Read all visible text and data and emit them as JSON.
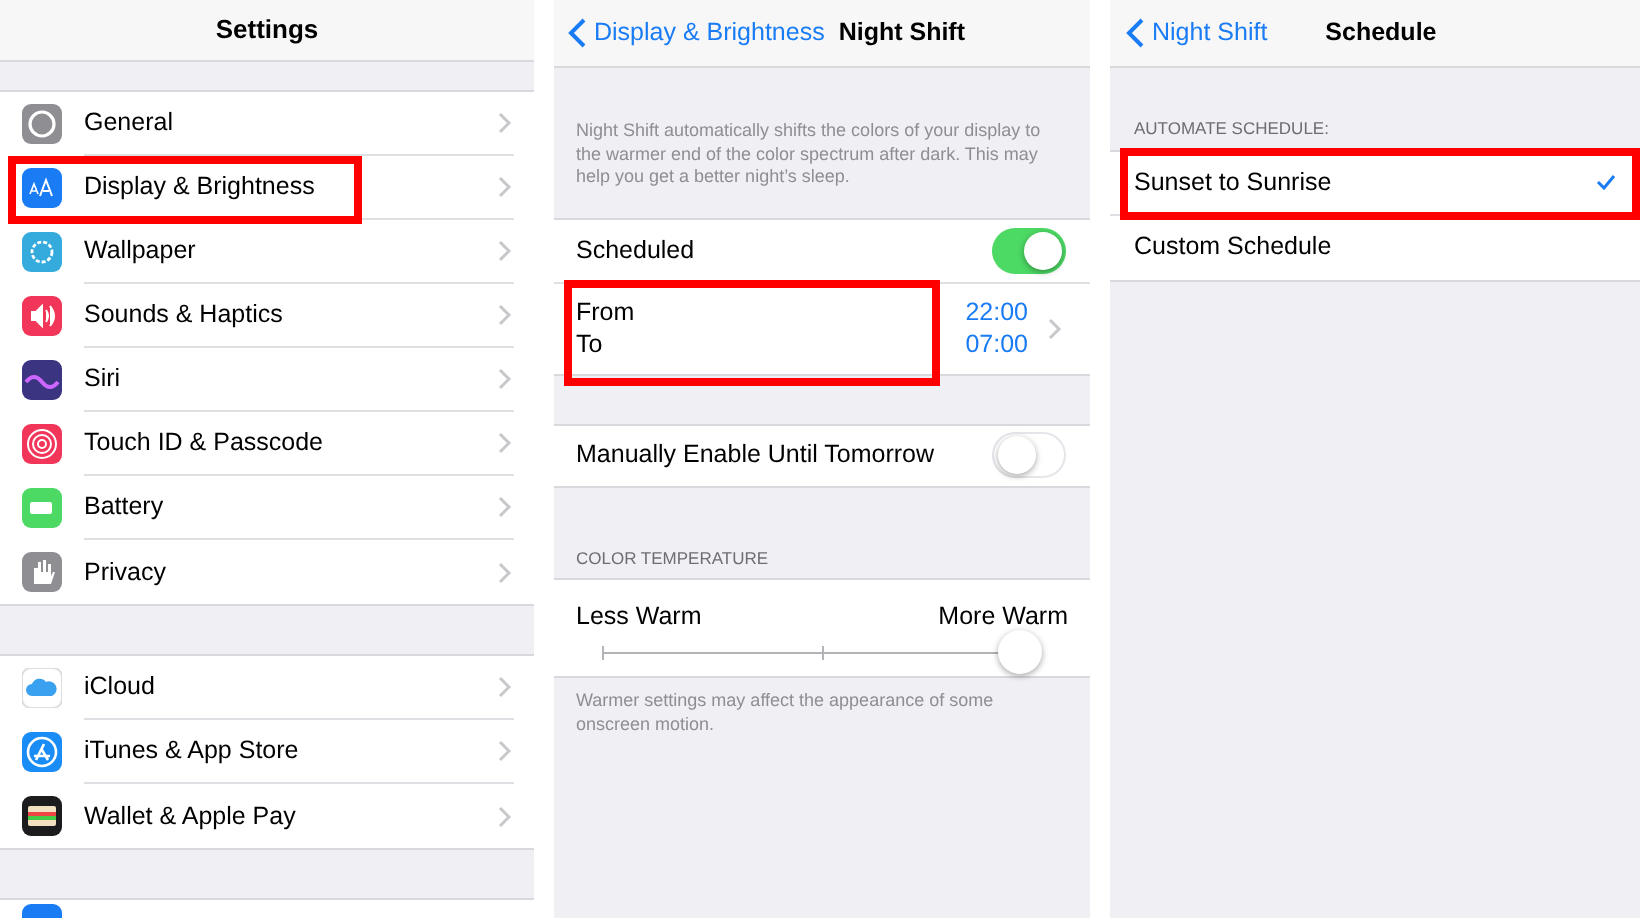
{
  "settings": {
    "title": "Settings",
    "groups": [
      [
        {
          "label": "General",
          "highlighted": false
        },
        {
          "label": "Display & Brightness",
          "highlighted": true
        },
        {
          "label": "Wallpaper",
          "highlighted": false
        },
        {
          "label": "Sounds & Haptics",
          "highlighted": false
        },
        {
          "label": "Siri",
          "highlighted": false
        },
        {
          "label": "Touch ID & Passcode",
          "highlighted": false
        },
        {
          "label": "Battery",
          "highlighted": false
        },
        {
          "label": "Privacy",
          "highlighted": false
        }
      ],
      [
        {
          "label": "iCloud",
          "highlighted": false
        },
        {
          "label": "iTunes & App Store",
          "highlighted": false
        },
        {
          "label": "Wallet & Apple Pay",
          "highlighted": false
        }
      ]
    ]
  },
  "night_shift": {
    "back": "Display & Brightness",
    "title": "Night Shift",
    "description": "Night Shift automatically shifts the colors of your display to the warmer end of the color spectrum after dark. This may help you get a better night’s sleep.",
    "scheduled": {
      "label": "Scheduled",
      "on": true
    },
    "from_to": {
      "from_label": "From",
      "to_label": "To",
      "from": "22:00",
      "to": "07:00",
      "highlighted": true
    },
    "manual": {
      "label": "Manually Enable Until Tomorrow",
      "on": false
    },
    "temperature_header": "COLOR TEMPERATURE",
    "temperature": {
      "min_label": "Less Warm",
      "max_label": "More Warm",
      "level": 0.95
    },
    "footer": "Warmer settings may affect the appearance of some onscreen motion."
  },
  "schedule": {
    "back": "Night Shift",
    "title": "Schedule",
    "header": "AUTOMATE SCHEDULE:",
    "options": [
      {
        "label": "Sunset to Sunrise",
        "selected": true,
        "highlighted": true
      },
      {
        "label": "Custom Schedule",
        "selected": false,
        "highlighted": false
      }
    ]
  }
}
